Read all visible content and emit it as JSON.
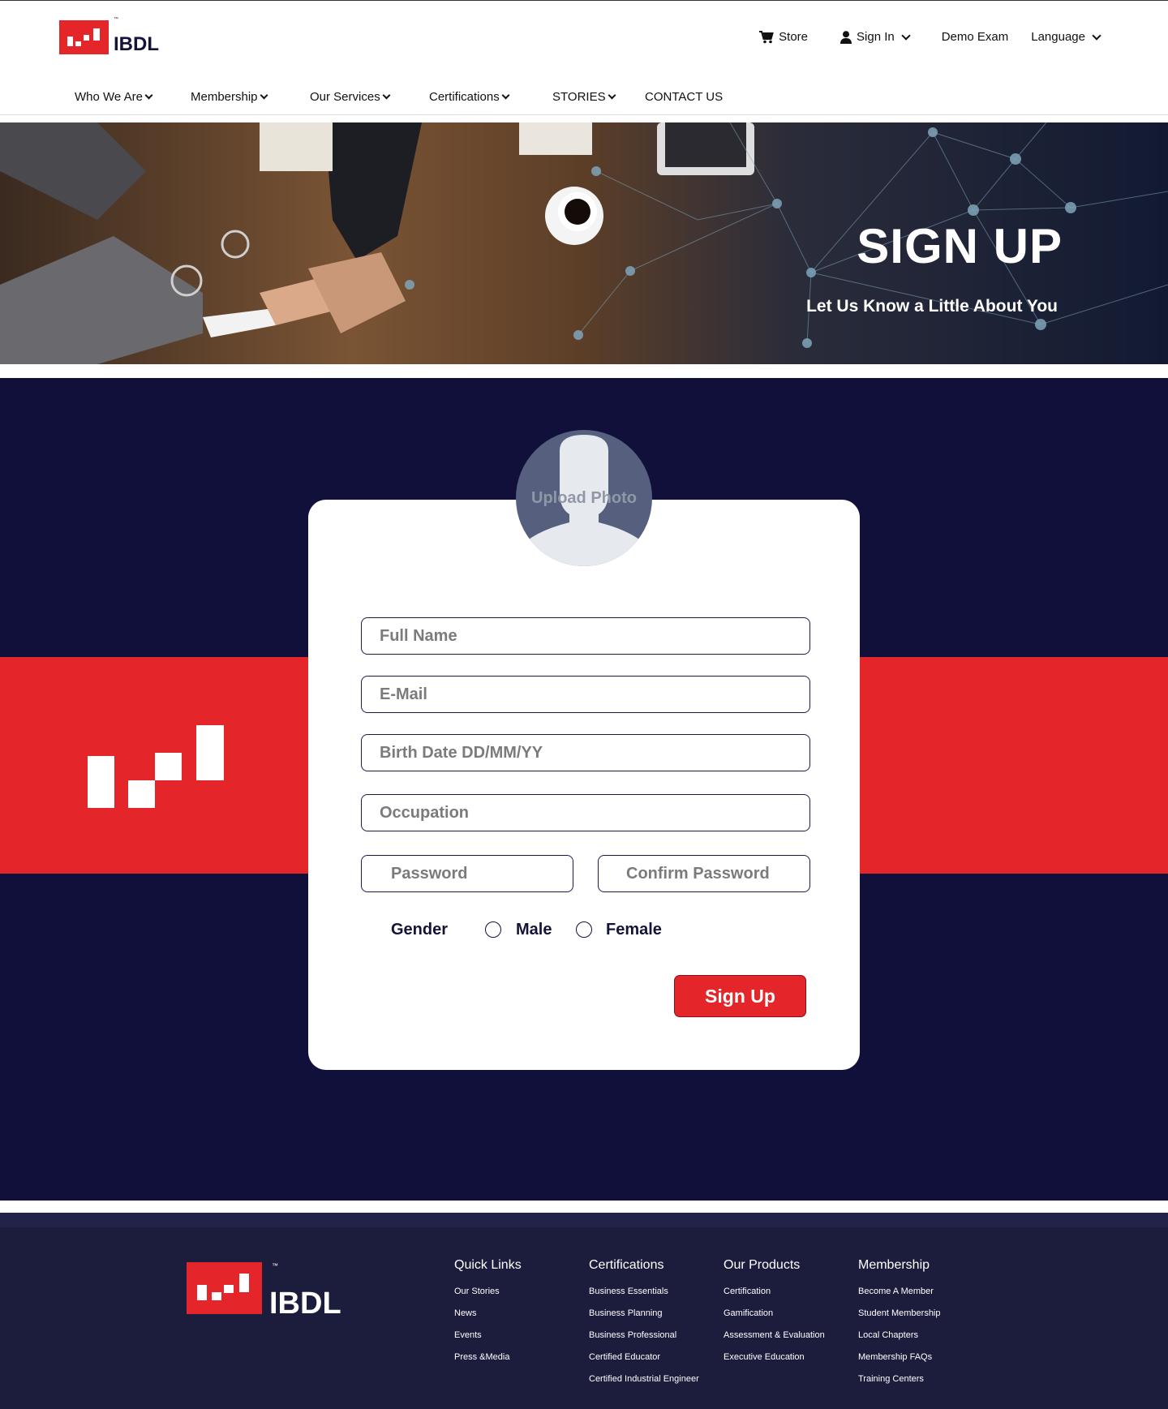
{
  "header": {
    "brand": "IBDL",
    "tm": "™",
    "utility": [
      {
        "label": "Store",
        "icon": "cart-icon"
      },
      {
        "label": "Sign In",
        "icon": "user-icon",
        "dropdown": true
      },
      {
        "label": "Demo Exam"
      },
      {
        "label": "Language",
        "dropdown": true
      }
    ],
    "nav": [
      {
        "label": "Who We Are",
        "dropdown": true
      },
      {
        "label": "Membership",
        "dropdown": true
      },
      {
        "label": "Our Services",
        "dropdown": true
      },
      {
        "label": "Certifications",
        "dropdown": true
      },
      {
        "label": "STORIES",
        "dropdown": true
      },
      {
        "label": "CONTACT US",
        "dropdown": false
      }
    ]
  },
  "hero": {
    "title": "SIGN UP",
    "subtitle": "Let Us Know a Little About You"
  },
  "form": {
    "upload_photo": "Upload Photo",
    "full_name_placeholder": "Full Name",
    "email_placeholder": "E-Mail",
    "birth_date_placeholder": "Birth Date DD/MM/YY",
    "occupation_placeholder": "Occupation",
    "password_placeholder": "Password",
    "confirm_password_placeholder": "Confirm Password",
    "gender_label": "Gender",
    "gender_options": [
      "Male",
      "Female"
    ],
    "submit_label": "Sign Up"
  },
  "footer": {
    "brand": "IBDL",
    "tm": "™",
    "columns": [
      {
        "title": "Quick Links",
        "links": [
          "Our Stories",
          "News",
          "Events",
          "Press &Media"
        ]
      },
      {
        "title": "Certifications",
        "links": [
          "Business Essentials",
          "Business Planning",
          "Business Professional",
          "Certified Educator",
          "Certified Industrial Engineer"
        ]
      },
      {
        "title": "Our Products",
        "links": [
          "Certification",
          "Gamification",
          "Assessment & Evaluation",
          "Executive Education"
        ]
      },
      {
        "title": "Membership",
        "links": [
          "Become A Member",
          "Student Membership",
          "Local Chapters",
          "Membership FAQs",
          "Training Centers"
        ]
      }
    ]
  },
  "colors": {
    "brand_red": "#e4262b",
    "navy": "#10103a",
    "footer_bg": "#1c1c3c"
  }
}
